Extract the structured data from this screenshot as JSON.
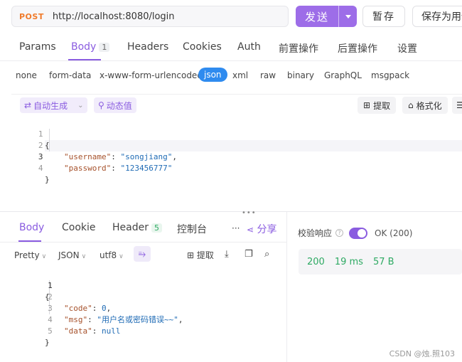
{
  "request": {
    "method": "POST",
    "url": "http://localhost:8080/login",
    "send_label": "发送",
    "save_label": "暂存",
    "save_as_label": "保存为用例"
  },
  "req_tabs": [
    {
      "label": "Params"
    },
    {
      "label": "Body",
      "badge": "1"
    },
    {
      "label": "Headers"
    },
    {
      "label": "Cookies"
    },
    {
      "label": "Auth"
    },
    {
      "label": "前置操作"
    },
    {
      "label": "后置操作"
    },
    {
      "label": "设置"
    }
  ],
  "body_types": [
    "none",
    "form-data",
    "x-www-form-urlencoded",
    "json",
    "xml",
    "raw",
    "binary",
    "GraphQL",
    "msgpack"
  ],
  "editor_toolbar": {
    "auto_gen": "自动生成",
    "dynamic_value": "动态值",
    "extract": "提取",
    "format": "格式化"
  },
  "request_code": [
    {
      "n": "1",
      "text": "{"
    },
    {
      "n": "2",
      "key": "\"username\"",
      "value": "\"songjiang\"",
      "tail": ","
    },
    {
      "n": "3",
      "key": "\"password\"",
      "value": "\"123456777\"",
      "tail": ""
    },
    {
      "n": "4",
      "text": "}"
    }
  ],
  "response": {
    "tabs": [
      {
        "label": "Body"
      },
      {
        "label": "Cookie"
      },
      {
        "label": "Header",
        "badge": "5"
      },
      {
        "label": "控制台"
      }
    ],
    "more": "···",
    "share": "分享",
    "format_options": {
      "pretty": "Pretty",
      "json": "JSON",
      "encoding": "utf8"
    },
    "extract": "提取",
    "code": [
      {
        "n": "1",
        "text": "{"
      },
      {
        "n": "2",
        "key": "\"code\"",
        "value": "0",
        "tail": ","
      },
      {
        "n": "3",
        "key": "\"msg\"",
        "value": "\"用户名或密码错误~~\"",
        "tail": ","
      },
      {
        "n": "4",
        "key": "\"data\"",
        "value": "null",
        "tail": ""
      },
      {
        "n": "5",
        "text": "}"
      }
    ],
    "validate_label": "校验响应",
    "validate_result": "OK (200)",
    "status_code": "200",
    "time": "19 ms",
    "size": "57 B"
  },
  "watermark": "CSDN @烛.照103",
  "colors": {
    "accent": "#8a5ce0",
    "method": "#f07b2b",
    "json_active": "#2f8bef",
    "success": "#2eaa63"
  }
}
